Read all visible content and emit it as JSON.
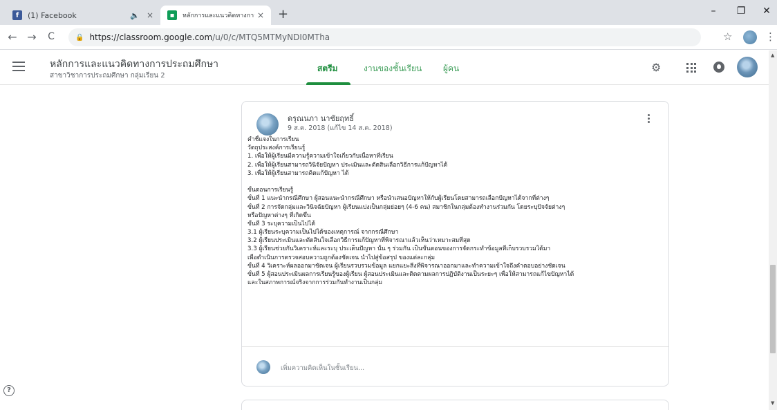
{
  "browser": {
    "tabs": [
      {
        "favicon": "facebook-icon",
        "title": "(1) Facebook",
        "muted": true
      },
      {
        "favicon": "classroom-icon",
        "title": "หลักการและแนวคิดทางการประถมศึกษา",
        "active": true
      }
    ],
    "mute_glyph": "🔈",
    "close_glyph": "×",
    "newtab_glyph": "+",
    "url_main": "https://classroom.google.com",
    "url_rest": "/u/0/c/MTQ5MTMyNDI0MTha",
    "window_controls": {
      "minimize": "–",
      "restore": "❐",
      "close": "✕"
    },
    "nav": {
      "back": "←",
      "forward": "→",
      "reload": "C"
    },
    "bookmark_glyph": "☆",
    "menu_glyph": "⋮"
  },
  "classroom": {
    "title": "หลักการและแนวคิดทางการประถมศึกษา",
    "subtitle": "สาขาวิชาการประถมศึกษา กลุ่มเรียน 2",
    "tabs": [
      {
        "label": "สตรีม",
        "active": true
      },
      {
        "label": "งานของชั้นเรียน",
        "active": false
      },
      {
        "label": "ผู้คน",
        "active": false
      }
    ],
    "settings_glyph": "⚙"
  },
  "post": {
    "author": "ดรุณนภา นาชัยฤทธิ์",
    "date": "9 ส.ค. 2018 (แก้ไข 14 ส.ค. 2018)",
    "lines": [
      "คำชี้แจงในการเรียน",
      "วัตถุประสงค์การเรียนรู้",
      "1. เพื่อให้ผู้เรียนมีความรู้ความเข้าใจเกี่ยวกับเนื้อหาที่เรียน",
      "2. เพื่อให้ผู้เรียนสามารถวินิจัยปัญหา ประเมินและตัดสินเลือกวิธีการแก้ปัญหาได้",
      "3. เพื่อให้ผู้เรียนสามารถคิดแก้ปัญหา ได้",
      "",
      "ขั้นตอนการเรียนรู้",
      "ขั้นที่ 1 แนะนำกรณีศึกษา ผู้สอนแนะนำกรณีศึกษา หรือนำเสนอปัญหาให้กับผู้เรียนโดยสามารถเลือกปัญหาได้จากที่ต่างๆ",
      "ขั้นที่ 2 การจัดกลุ่มและวินิจฉัยปัญหา ผู้เรียนแบ่งเป็นกลุ่มย่อยๆ (4-6 คน) สมาชิกในกลุ่มต้องทำงานร่วมกัน โดยระบุปัจจัยต่างๆ",
      "หรือปัญหาต่างๆ ที่เกิดขึ้น",
      "ขั้นที่ 3 ระบุความเป็นไปได้",
      "3.1 ผู้เรียนระบุความเป็นไปได้ของเหตุการณ์ จากกรณีศึกษา",
      "3.2 ผู้เรียนประเมินและตัดสินใจเลือกวิธีการแก้ปัญหาที่พิจารณาแล้วเห็นว่าเหมาะสมที่สุด",
      "3.3 ผู้เรียนช่วยกันวิเคราะห์และระบุ ประเด็นปัญหา นั้น ๆ ร่วมกัน เป็นขั้นตอนของการจัดกระทำข้อมูลที่เก็บรวบรวมได้มา",
      "เพื่อดำเนินการตรวจสอบความถูกต้องชัดเจน นำไปสู่ข้อสรุป ของแต่ละกลุ่ม",
      "ขั้นที่ 4 วิเคราะห์ผลออกมาชัดเจน ผู้เรียนรวบรวมข้อมูล แยกแยะสิ่งที่พิจารณาออกมาและทำความเข้าใจถึงคำตอบอย่างชัดเจน",
      "ขั้นที่ 5 ผู้สอนประเมินผลการเรียนรู้ของผู้เรียน ผู้สอนประเมินและติดตามผลการปฏิบัติงานเป็นระยะๆ เพื่อให้สามารถแก้ไขปัญหาได้",
      "และในสภาพการณ์จริงจากการร่วมกันทำงานเป็นกลุ่ม"
    ],
    "comment_placeholder": "เพิ่มความคิดเห็นในชั้นเรียน..."
  },
  "help_glyph": "?",
  "colors": {
    "accent": "#1e8e3e",
    "facebook": "#3b5998",
    "classroom_tab": "#0f9d58"
  }
}
